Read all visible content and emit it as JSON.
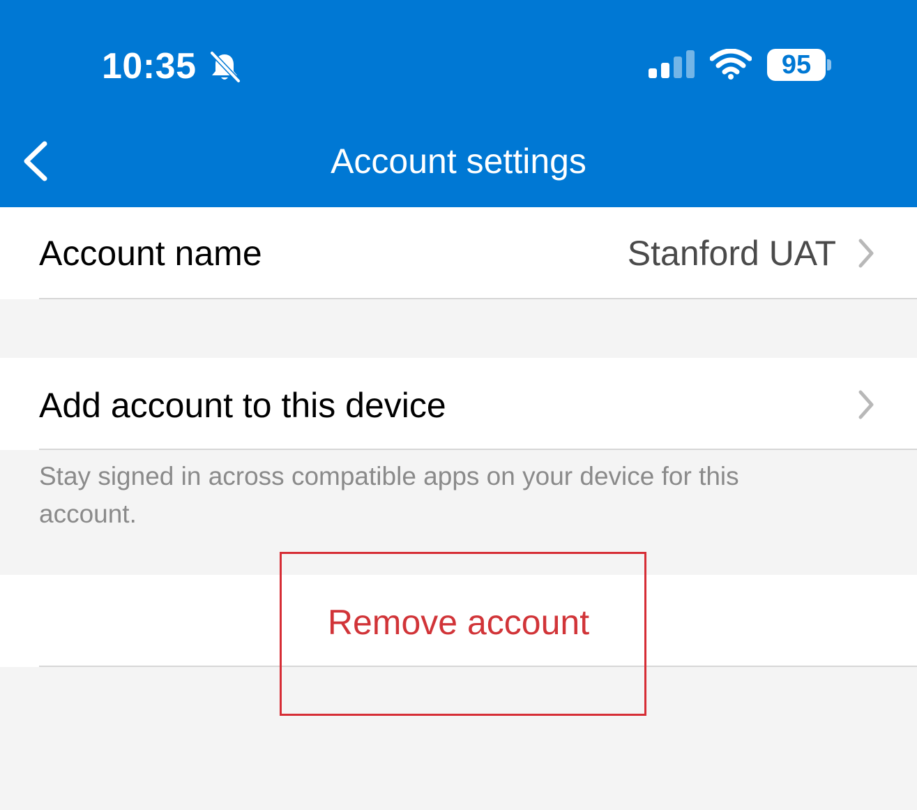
{
  "status_bar": {
    "time": "10:35",
    "battery": "95",
    "icons": [
      "bell-slash-icon",
      "cellular-signal-icon",
      "wifi-icon",
      "battery-icon"
    ]
  },
  "nav": {
    "title": "Account settings",
    "back_icon": "chevron-left-icon"
  },
  "account_name_row": {
    "label": "Account name",
    "value": "Stanford UAT"
  },
  "add_account_row": {
    "label": "Add account to this device",
    "description": "Stay signed in across compatible apps on your device for this account."
  },
  "remove_account": {
    "label": "Remove account"
  },
  "colors": {
    "brand_blue": "#0078d4",
    "destructive_red": "#d13438",
    "highlight_red": "#d62d35",
    "background": "#f4f4f4"
  }
}
